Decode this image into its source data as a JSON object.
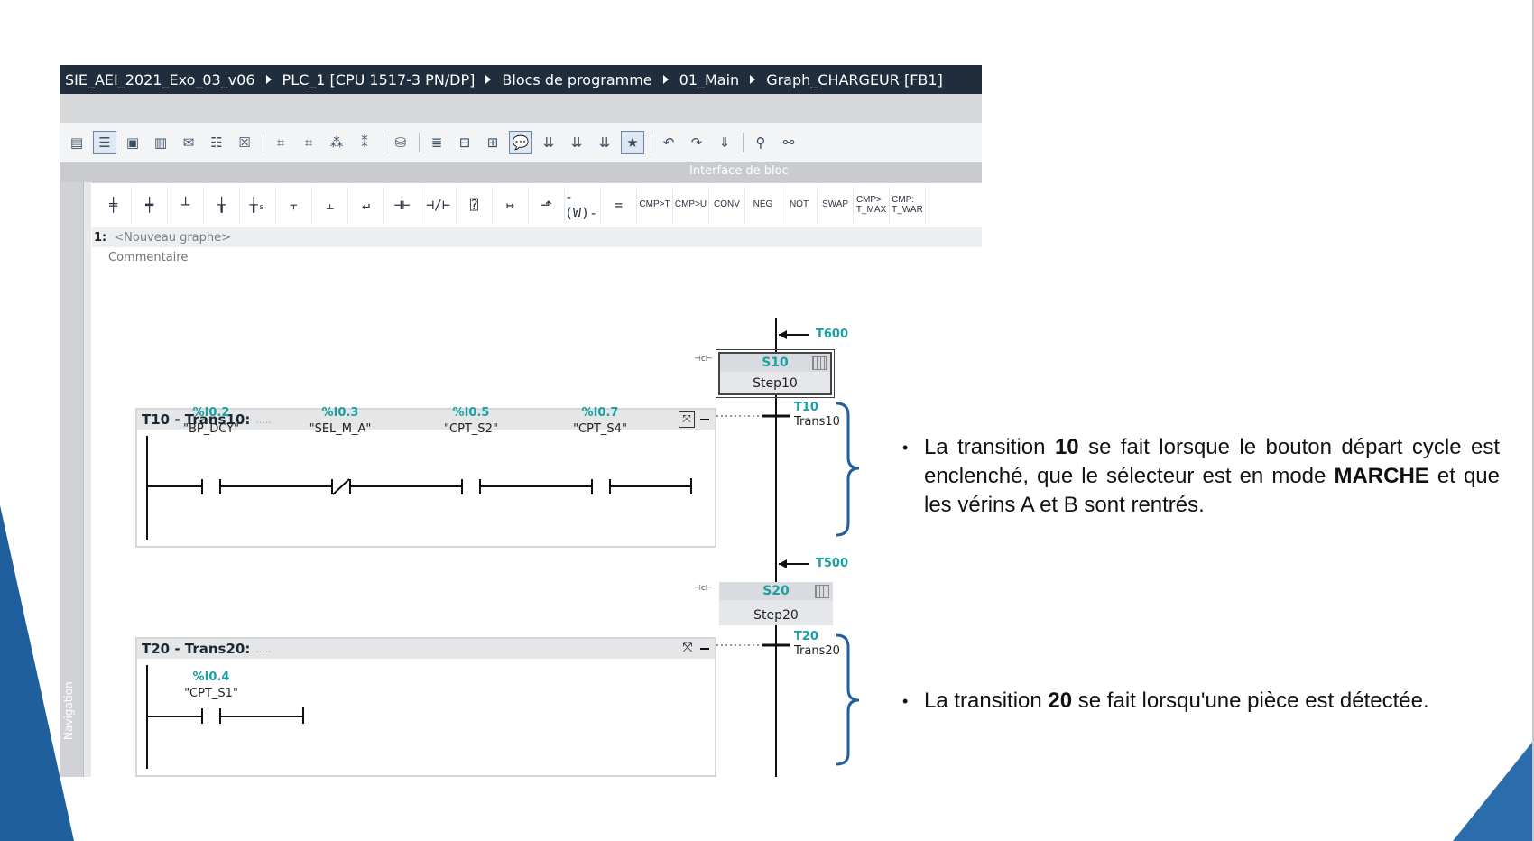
{
  "breadcrumb": {
    "items": [
      "SIE_AEI_2021_Exo_03_v06",
      "PLC_1 [CPU 1517-3 PN/DP]",
      "Blocs de programme",
      "01_Main",
      "Graph_CHARGEUR [FB1]"
    ]
  },
  "toolbar": {
    "interface_label": "Interface de bloc"
  },
  "ladder_toolbar": {
    "text_buttons": [
      "CMP>T",
      "CMP>U",
      "CONV",
      "NEG",
      "NOT",
      "SWAP",
      "CMP>\nT_MAX",
      "CMP:\nT_WAR"
    ]
  },
  "side_panel": {
    "navigation_label": "Navigation"
  },
  "network": {
    "number": "1:",
    "name": "<Nouveau graphe>",
    "comment": "Commentaire"
  },
  "graph": {
    "jumps": {
      "top": "T600",
      "mid": "T500"
    },
    "steps": [
      {
        "id": "S10",
        "name": "Step10"
      },
      {
        "id": "S20",
        "name": "Step20"
      }
    ],
    "transitions": [
      {
        "id": "T10",
        "name": "Trans10",
        "header": "T10 - Trans10:",
        "contacts": [
          {
            "address": "%I0.2",
            "tag": "\"BP_DCY\""
          },
          {
            "address": "%I0.3",
            "tag": "\"SEL_M_A\""
          },
          {
            "address": "%I0.5",
            "tag": "\"CPT_S2\""
          },
          {
            "address": "%I0.7",
            "tag": "\"CPT_S4\""
          }
        ]
      },
      {
        "id": "T20",
        "name": "Trans20",
        "header": "T20 - Trans20:",
        "contacts": [
          {
            "address": "%I0.4",
            "tag": "\"CPT_S1\""
          }
        ]
      }
    ]
  },
  "notes": {
    "t10": {
      "pre": "La transition ",
      "num": "10",
      "mid": " se fait lorsque le bouton départ cycle est enclenché, que le sélecteur est en mode ",
      "mode": "MARCHE",
      "post": " et que les vérins A et B sont rentrés."
    },
    "t20": {
      "pre": "La transition ",
      "num": "20",
      "post": " se fait lorsqu'une pièce est détectée."
    }
  },
  "colors": {
    "accent": "#1f5f9e",
    "teal": "#1aa0a0",
    "titlebar": "#1f2d3d"
  }
}
